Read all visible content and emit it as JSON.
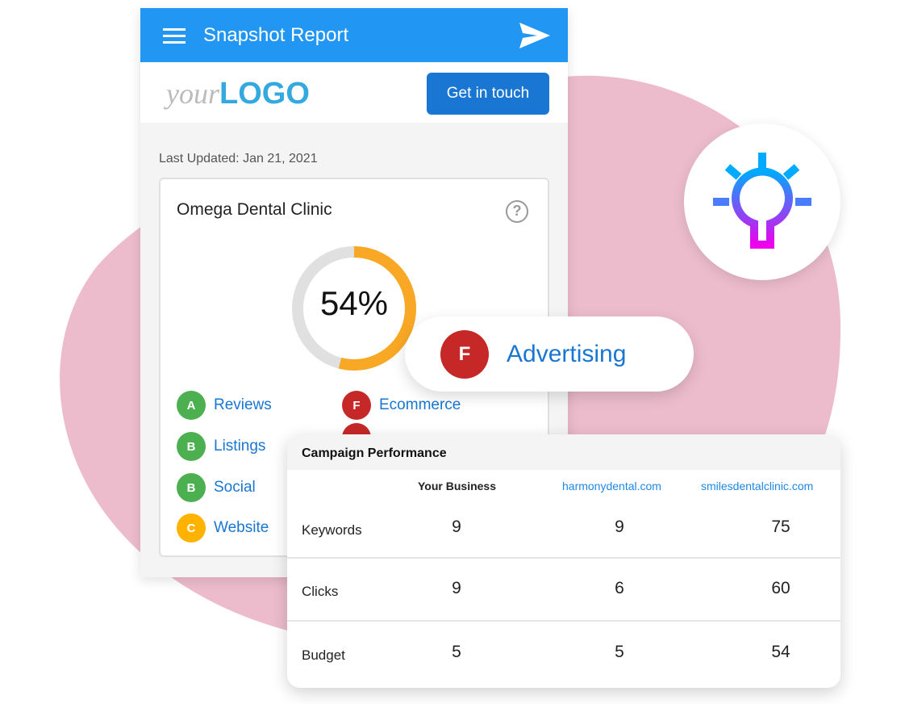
{
  "header": {
    "title": "Snapshot Report",
    "menu_icon": "hamburger-icon",
    "send_icon": "send-icon",
    "color": "#2196f3"
  },
  "logo": {
    "your": "your",
    "logo": "LOGO"
  },
  "get_in_touch": "Get in touch",
  "last_updated": "Last Updated: Jan 21, 2021",
  "business": {
    "name": "Omega Dental Clinic",
    "score": "54%",
    "score_value": 54,
    "help_icon": "?"
  },
  "grades": [
    {
      "grade": "A",
      "label": "Reviews",
      "color": "#4caf50"
    },
    {
      "grade": "B",
      "label": "Listings",
      "color": "#4caf50"
    },
    {
      "grade": "B",
      "label": "Social",
      "color": "#4caf50"
    },
    {
      "grade": "C",
      "label": "Website",
      "color": "#ffb300"
    },
    {
      "grade": "F",
      "label": "Ecommerce",
      "color": "#c62828"
    }
  ],
  "advertising": {
    "grade": "F",
    "label": "Advertising"
  },
  "campaign": {
    "title": "Campaign Performance",
    "columns": [
      "Your Business",
      "harmonydental.com",
      "smilesdentalclinic.com"
    ],
    "rows": [
      {
        "label": "Keywords",
        "values": [
          "9",
          "9",
          "75"
        ]
      },
      {
        "label": "Clicks",
        "values": [
          "9",
          "6",
          "60"
        ]
      },
      {
        "label": "Budget",
        "values": [
          "5",
          "5",
          "54"
        ]
      }
    ]
  }
}
